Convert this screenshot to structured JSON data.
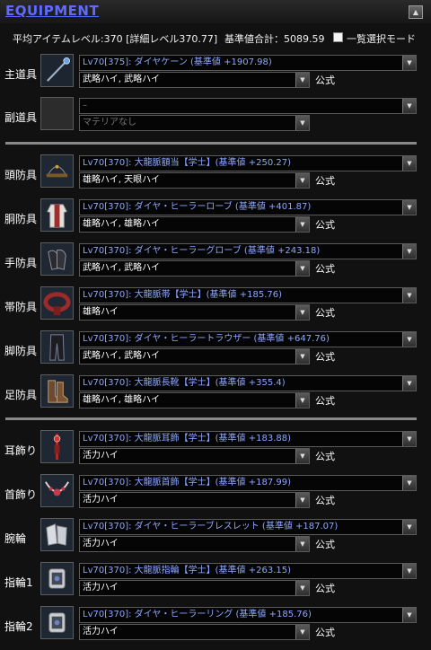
{
  "header": {
    "title": "EQUIPMENT",
    "collapse_icon": "▲"
  },
  "summary": {
    "avg_item_level": "平均アイテムレベル:370 [詳細レベル370.77]",
    "total_base_value": "基準値合計：5089.59",
    "list_select_mode_label": "一覧選択モード"
  },
  "formula_label": "公式",
  "dropdown_arrow": "▼",
  "slots": [
    {
      "label": "主道具",
      "icon": "cane-icon",
      "item": "Lv70[375]: ダイヤケーン (基準値 +1907.98)",
      "materia": "武略ハイ, 武略ハイ"
    },
    {
      "label": "副道具",
      "icon": "empty-slot-icon",
      "item": "–",
      "materia": "マテリアなし"
    },
    {
      "label": "頭防具",
      "icon": "hat-icon",
      "item": "Lv70[370]: 大龍脈額当【学士】(基準値 +250.27)",
      "materia": "雄略ハイ, 天眼ハイ"
    },
    {
      "label": "胴防具",
      "icon": "robe-icon",
      "item": "Lv70[370]: ダイヤ・ヒーラーローブ (基準値 +401.87)",
      "materia": "雄略ハイ, 雄略ハイ"
    },
    {
      "label": "手防具",
      "icon": "gloves-icon",
      "item": "Lv70[370]: ダイヤ・ヒーラーグローブ (基準値 +243.18)",
      "materia": "武略ハイ, 武略ハイ"
    },
    {
      "label": "帯防具",
      "icon": "belt-icon",
      "item": "Lv70[370]: 大龍脈帯【学士】(基準値 +185.76)",
      "materia": "雄略ハイ"
    },
    {
      "label": "脚防具",
      "icon": "trousers-icon",
      "item": "Lv70[370]: ダイヤ・ヒーラートラウザー (基準値 +647.76)",
      "materia": "武略ハイ, 武略ハイ"
    },
    {
      "label": "足防具",
      "icon": "boots-icon",
      "item": "Lv70[370]: 大龍脈長靴【学士】(基準値 +355.4)",
      "materia": "雄略ハイ, 雄略ハイ"
    },
    {
      "label": "耳飾り",
      "icon": "earring-icon",
      "item": "Lv70[370]: 大龍脈耳飾【学士】(基準値 +183.88)",
      "materia": "活力ハイ"
    },
    {
      "label": "首飾り",
      "icon": "necklace-icon",
      "item": "Lv70[370]: 大龍脈首飾【学士】(基準値 +187.99)",
      "materia": "活力ハイ"
    },
    {
      "label": "腕輪",
      "icon": "bracelet-icon",
      "item": "Lv70[370]: ダイヤ・ヒーラーブレスレット (基準値 +187.07)",
      "materia": "活力ハイ"
    },
    {
      "label": "指輪1",
      "icon": "ring-icon",
      "item": "Lv70[370]: 大龍脈指輪【学士】(基準値 +263.15)",
      "materia": "活力ハイ"
    },
    {
      "label": "指輪2",
      "icon": "ring-icon",
      "item": "Lv70[370]: ダイヤ・ヒーラーリング (基準値 +185.76)",
      "materia": "活力ハイ"
    }
  ]
}
